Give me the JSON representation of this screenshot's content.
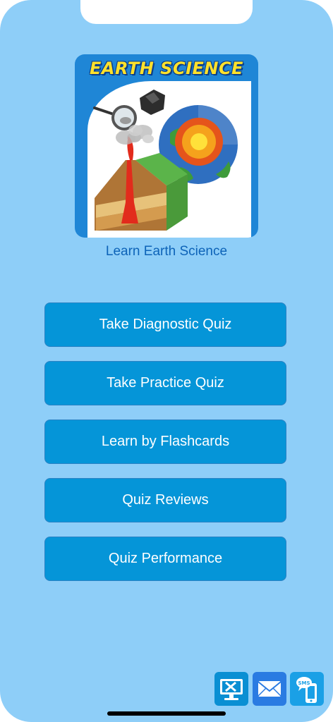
{
  "logo": {
    "title": "EARTH SCIENCE",
    "icon": "earth-science-logo",
    "brand_color": "#1f86d6"
  },
  "app_subtitle": "Learn Earth Science",
  "menu": {
    "button_color": "#0595d8",
    "items": [
      {
        "label": "Take Diagnostic Quiz"
      },
      {
        "label": "Take Practice Quiz"
      },
      {
        "label": "Learn by Flashcards"
      },
      {
        "label": "Quiz Reviews"
      },
      {
        "label": "Quiz Performance"
      }
    ]
  },
  "bottom_bar": {
    "icons": [
      {
        "icon": "tools-monitor-icon"
      },
      {
        "icon": "mail-icon"
      },
      {
        "icon": "sms-phone-icon"
      }
    ],
    "sms_label": "SMS"
  },
  "background_color": "#8ecef8"
}
